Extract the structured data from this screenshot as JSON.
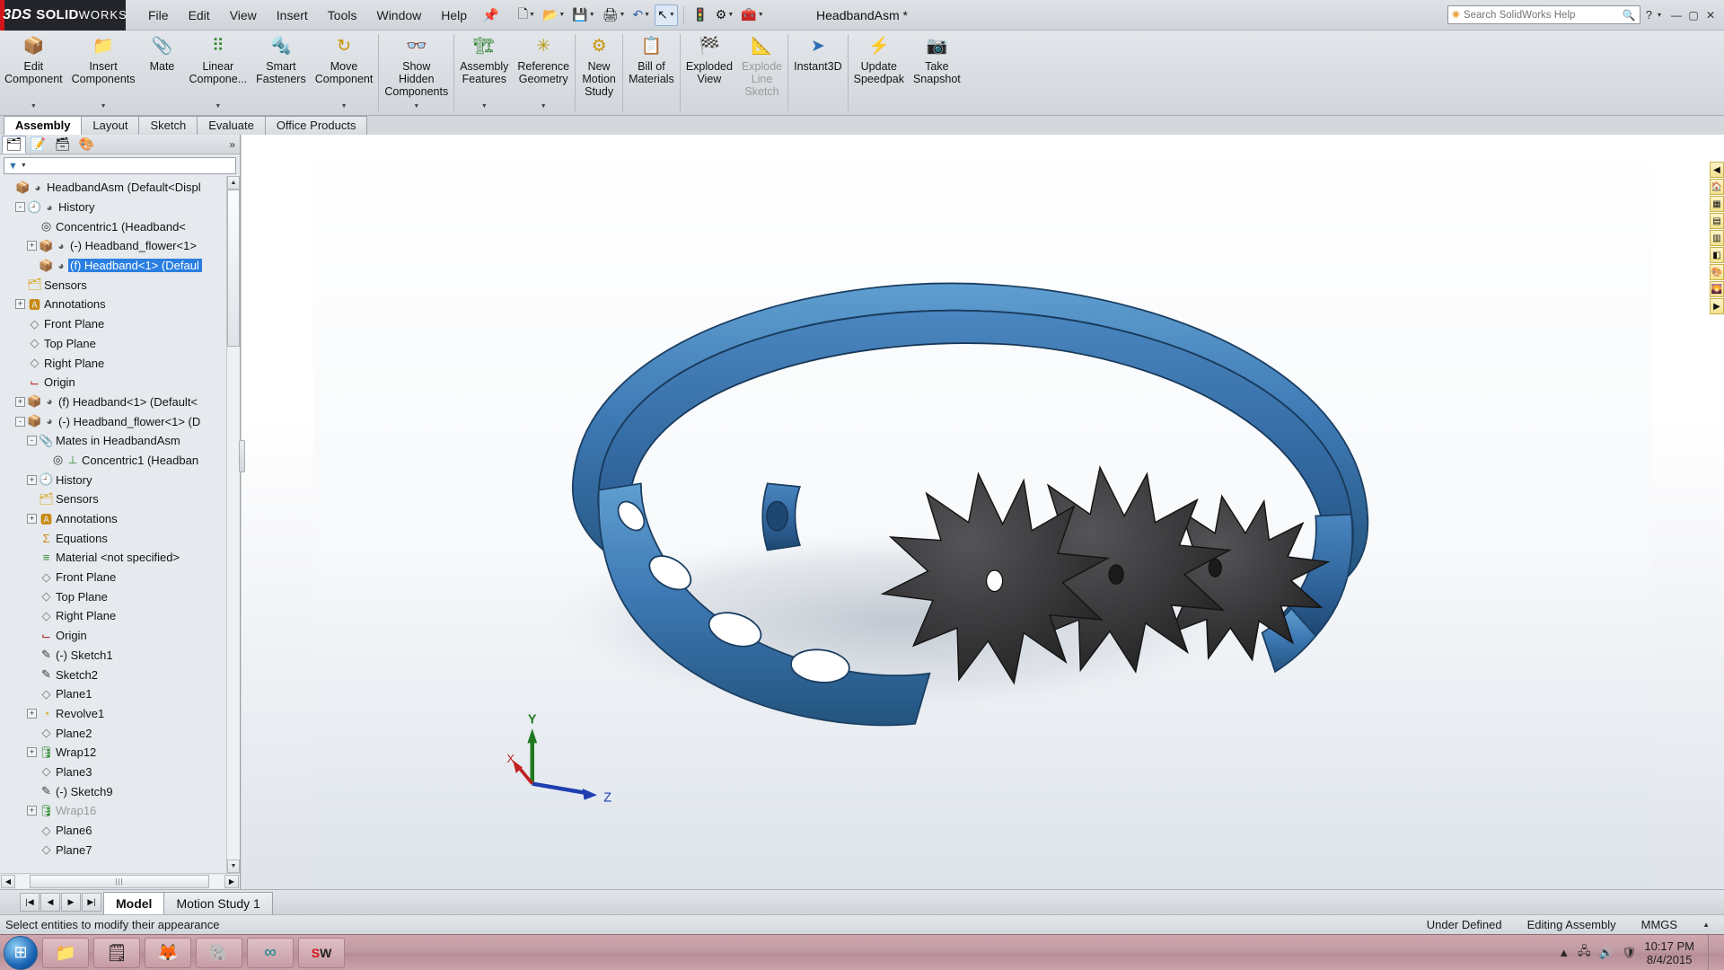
{
  "app": {
    "brand_d1": "3DS",
    "brand_d2": "SOLID",
    "brand_d3": "WORKS",
    "document_title": "HeadbandAsm *"
  },
  "menu": {
    "items": [
      "File",
      "Edit",
      "View",
      "Insert",
      "Tools",
      "Window",
      "Help"
    ]
  },
  "quick_tools": [
    {
      "name": "new-document",
      "glyph": "🗋",
      "caret": true
    },
    {
      "name": "open-document",
      "glyph": "📂",
      "caret": true
    },
    {
      "name": "save-document",
      "glyph": "💾",
      "caret": true
    },
    {
      "name": "print",
      "glyph": "🖨",
      "caret": true
    },
    {
      "name": "undo",
      "glyph": "↶",
      "caret": true
    },
    {
      "name": "select",
      "glyph": "↖",
      "caret": true,
      "selected": true
    },
    {
      "name": "rebuild",
      "glyph": "🚦",
      "caret": false
    },
    {
      "name": "options",
      "glyph": "⚙",
      "caret": false
    },
    {
      "name": "toolbox",
      "glyph": "🧰",
      "caret": true
    }
  ],
  "search": {
    "placeholder": "Search SolidWorks Help",
    "value": ""
  },
  "window_controls": {
    "help_caret": "?",
    "minimize": "—",
    "maximize": "▢",
    "close": "✕"
  },
  "ribbon": {
    "groups": [
      {
        "buttons": [
          {
            "label": "Edit\nComponent",
            "icon": "edit-component-icon",
            "glyph": "📦",
            "caret": true,
            "disabled": false
          },
          {
            "label": "Insert\nComponents",
            "icon": "insert-components-icon",
            "glyph": "📁",
            "caret": true,
            "disabled": false
          },
          {
            "label": "Mate",
            "icon": "mate-icon",
            "glyph": "📎",
            "caret": false,
            "disabled": false
          },
          {
            "label": "Linear\nCompone...",
            "icon": "linear-component-pattern-icon",
            "glyph": "⠿",
            "caret": true,
            "disabled": false
          },
          {
            "label": "Smart\nFasteners",
            "icon": "smart-fasteners-icon",
            "glyph": "🔩",
            "caret": false,
            "disabled": false
          },
          {
            "label": "Move\nComponent",
            "icon": "move-component-icon",
            "glyph": "↻",
            "caret": true,
            "disabled": false
          }
        ]
      },
      {
        "buttons": [
          {
            "label": "Show\nHidden\nComponents",
            "icon": "show-hidden-components-icon",
            "glyph": "👁",
            "caret": true,
            "disabled": false
          }
        ]
      },
      {
        "buttons": [
          {
            "label": "Assembly\nFeatures",
            "icon": "assembly-features-icon",
            "glyph": "🏗",
            "caret": true,
            "disabled": false
          },
          {
            "label": "Reference\nGeometry",
            "icon": "reference-geometry-icon",
            "glyph": "✳",
            "caret": true,
            "disabled": false
          }
        ]
      },
      {
        "buttons": [
          {
            "label": "New\nMotion\nStudy",
            "icon": "new-motion-study-icon",
            "glyph": "⚙",
            "caret": false,
            "disabled": false
          }
        ]
      },
      {
        "buttons": [
          {
            "label": "Bill of\nMaterials",
            "icon": "bill-of-materials-icon",
            "glyph": "📋",
            "caret": false,
            "disabled": false
          }
        ]
      },
      {
        "buttons": [
          {
            "label": "Exploded\nView",
            "icon": "exploded-view-icon",
            "glyph": "🏁",
            "caret": false,
            "disabled": false
          },
          {
            "label": "Explode\nLine\nSketch",
            "icon": "explode-line-sketch-icon",
            "glyph": "📐",
            "caret": false,
            "disabled": true
          }
        ]
      },
      {
        "buttons": [
          {
            "label": "Instant3D",
            "icon": "instant3d-icon",
            "glyph": "➤",
            "caret": false,
            "disabled": false
          }
        ]
      },
      {
        "buttons": [
          {
            "label": "Update\nSpeedpak",
            "icon": "update-speedpak-icon",
            "glyph": "⚡",
            "caret": false,
            "disabled": false
          },
          {
            "label": "Take\nSnapshot",
            "icon": "take-snapshot-icon",
            "glyph": "📷",
            "caret": false,
            "disabled": false
          }
        ]
      }
    ]
  },
  "command_tabs": {
    "items": [
      "Assembly",
      "Layout",
      "Sketch",
      "Evaluate",
      "Office Products"
    ],
    "active": "Assembly"
  },
  "left_panel": {
    "tabs": [
      {
        "name": "feature-manager-tab",
        "glyph": "🗂",
        "active": true
      },
      {
        "name": "property-manager-tab",
        "glyph": "📝",
        "active": false
      },
      {
        "name": "configuration-manager-tab",
        "glyph": "🗃",
        "active": false
      },
      {
        "name": "display-manager-tab",
        "glyph": "🎨",
        "active": false
      }
    ],
    "filter_placeholder": "",
    "tree": [
      {
        "indent": 0,
        "expander": "",
        "icon": "assembly-icon",
        "icon2": "coordinate-icon",
        "label": "HeadbandAsm  (Default<Displ",
        "selected": false,
        "dim": false
      },
      {
        "indent": 1,
        "expander": "-",
        "icon": "history-icon",
        "icon2": "coordinate-icon",
        "label": "History",
        "selected": false,
        "dim": false
      },
      {
        "indent": 2,
        "expander": "",
        "icon": "concentric-mate-icon",
        "icon2": "",
        "label": "Concentric1 (Headband<",
        "selected": false,
        "dim": false
      },
      {
        "indent": 2,
        "expander": "+",
        "icon": "part-icon",
        "icon2": "coordinate-icon",
        "label": "(-) Headband_flower<1>",
        "selected": false,
        "dim": false
      },
      {
        "indent": 2,
        "expander": "",
        "icon": "part-icon",
        "icon2": "coordinate-icon",
        "label": "(f) Headband<1> (Defaul",
        "selected": true,
        "dim": false
      },
      {
        "indent": 1,
        "expander": "",
        "icon": "sensors-icon",
        "icon2": "",
        "label": "Sensors",
        "selected": false,
        "dim": false
      },
      {
        "indent": 1,
        "expander": "+",
        "icon": "annotations-icon",
        "icon2": "",
        "label": "Annotations",
        "selected": false,
        "dim": false
      },
      {
        "indent": 1,
        "expander": "",
        "icon": "plane-icon",
        "icon2": "",
        "label": "Front Plane",
        "selected": false,
        "dim": false
      },
      {
        "indent": 1,
        "expander": "",
        "icon": "plane-icon",
        "icon2": "",
        "label": "Top Plane",
        "selected": false,
        "dim": false
      },
      {
        "indent": 1,
        "expander": "",
        "icon": "plane-icon",
        "icon2": "",
        "label": "Right Plane",
        "selected": false,
        "dim": false
      },
      {
        "indent": 1,
        "expander": "",
        "icon": "origin-icon",
        "icon2": "",
        "label": "Origin",
        "selected": false,
        "dim": false
      },
      {
        "indent": 1,
        "expander": "+",
        "icon": "part-icon",
        "icon2": "coordinate-icon",
        "label": "(f) Headband<1> (Default<",
        "selected": false,
        "dim": false
      },
      {
        "indent": 1,
        "expander": "-",
        "icon": "part-icon",
        "icon2": "coordinate-icon",
        "label": "(-) Headband_flower<1> (D",
        "selected": false,
        "dim": false
      },
      {
        "indent": 2,
        "expander": "-",
        "icon": "mates-folder-icon",
        "icon2": "",
        "label": "Mates in HeadbandAsm",
        "selected": false,
        "dim": false
      },
      {
        "indent": 3,
        "expander": "",
        "icon": "concentric-mate-icon",
        "icon2": "fixed-icon",
        "label": "Concentric1 (Headban",
        "selected": false,
        "dim": false
      },
      {
        "indent": 2,
        "expander": "+",
        "icon": "history-icon",
        "icon2": "",
        "label": "History",
        "selected": false,
        "dim": false
      },
      {
        "indent": 2,
        "expander": "",
        "icon": "sensors-icon",
        "icon2": "",
        "label": "Sensors",
        "selected": false,
        "dim": false
      },
      {
        "indent": 2,
        "expander": "+",
        "icon": "annotations-icon",
        "icon2": "",
        "label": "Annotations",
        "selected": false,
        "dim": false
      },
      {
        "indent": 2,
        "expander": "",
        "icon": "equations-icon",
        "icon2": "",
        "label": "Equations",
        "selected": false,
        "dim": false
      },
      {
        "indent": 2,
        "expander": "",
        "icon": "material-icon",
        "icon2": "",
        "label": "Material <not specified>",
        "selected": false,
        "dim": false
      },
      {
        "indent": 2,
        "expander": "",
        "icon": "plane-icon",
        "icon2": "",
        "label": "Front Plane",
        "selected": false,
        "dim": false
      },
      {
        "indent": 2,
        "expander": "",
        "icon": "plane-icon",
        "icon2": "",
        "label": "Top Plane",
        "selected": false,
        "dim": false
      },
      {
        "indent": 2,
        "expander": "",
        "icon": "plane-icon",
        "icon2": "",
        "label": "Right Plane",
        "selected": false,
        "dim": false
      },
      {
        "indent": 2,
        "expander": "",
        "icon": "origin-icon",
        "icon2": "",
        "label": "Origin",
        "selected": false,
        "dim": false
      },
      {
        "indent": 2,
        "expander": "",
        "icon": "sketch-icon",
        "icon2": "",
        "label": "(-) Sketch1",
        "selected": false,
        "dim": false
      },
      {
        "indent": 2,
        "expander": "",
        "icon": "sketch-icon",
        "icon2": "",
        "label": "Sketch2",
        "selected": false,
        "dim": false
      },
      {
        "indent": 2,
        "expander": "",
        "icon": "plane-icon",
        "icon2": "",
        "label": "Plane1",
        "selected": false,
        "dim": false
      },
      {
        "indent": 2,
        "expander": "+",
        "icon": "revolve-icon",
        "icon2": "",
        "label": "Revolve1",
        "selected": false,
        "dim": false
      },
      {
        "indent": 2,
        "expander": "",
        "icon": "plane-icon",
        "icon2": "",
        "label": "Plane2",
        "selected": false,
        "dim": false
      },
      {
        "indent": 2,
        "expander": "+",
        "icon": "wrap-icon",
        "icon2": "",
        "label": "Wrap12",
        "selected": false,
        "dim": false
      },
      {
        "indent": 2,
        "expander": "",
        "icon": "plane-icon",
        "icon2": "",
        "label": "Plane3",
        "selected": false,
        "dim": false
      },
      {
        "indent": 2,
        "expander": "",
        "icon": "sketch-icon",
        "icon2": "",
        "label": "(-) Sketch9",
        "selected": false,
        "dim": false
      },
      {
        "indent": 2,
        "expander": "+",
        "icon": "wrap-icon",
        "icon2": "",
        "label": "Wrap16",
        "selected": false,
        "dim": true
      },
      {
        "indent": 2,
        "expander": "",
        "icon": "plane-icon",
        "icon2": "",
        "label": "Plane6",
        "selected": false,
        "dim": false
      },
      {
        "indent": 2,
        "expander": "",
        "icon": "plane-icon",
        "icon2": "",
        "label": "Plane7",
        "selected": false,
        "dim": false
      }
    ]
  },
  "view_toolbar": [
    {
      "name": "zoom-to-fit-icon",
      "glyph": "🔍",
      "caret": false
    },
    {
      "name": "zoom-to-area-icon",
      "glyph": "🔎",
      "caret": false
    },
    {
      "name": "previous-view-icon",
      "glyph": "↺",
      "caret": false
    },
    {
      "name": "section-view-icon",
      "glyph": "◨",
      "caret": false
    },
    {
      "name": "view-orientation-icon",
      "glyph": "⬛",
      "caret": false
    },
    {
      "name": "display-style-icon",
      "glyph": "▣",
      "caret": true
    },
    {
      "name": "hide-show-items-icon",
      "glyph": "👓",
      "caret": true
    },
    {
      "name": "edit-appearance-icon",
      "glyph": "🎨",
      "caret": true
    },
    {
      "name": "apply-scene-icon",
      "glyph": "🌄",
      "caret": true
    },
    {
      "name": "view-settings-icon",
      "glyph": "🖵",
      "caret": true
    }
  ],
  "graphics_window_controls": {
    "restore_all": "⧉",
    "tile": "⊞",
    "minimize": "—",
    "restore": "❐",
    "close": "✕"
  },
  "triad": {
    "x_label": "X",
    "y_label": "Y",
    "z_label": "Z",
    "x_color": "#c02020",
    "y_color": "#1f7a1f",
    "z_color": "#1f3fb0"
  },
  "model": {
    "headband_color": "#3f7ab5",
    "headband_dark": "#2d5c8d",
    "flower_color": "#3a3a3a",
    "flower_dark": "#262626",
    "shadow_color": "#c9ced6"
  },
  "bottom": {
    "nav_buttons": [
      "|◀",
      "◀",
      "▶",
      "▶|"
    ],
    "tabs": [
      {
        "label": "Model",
        "active": true
      },
      {
        "label": "Motion Study 1",
        "active": false
      }
    ]
  },
  "status_bar": {
    "message": "Select entities to modify their appearance",
    "state": "Under Defined",
    "mode": "Editing Assembly",
    "units": "MMGS",
    "caret": "▲"
  },
  "taskbar": {
    "start_glyph": "⊞",
    "items": [
      {
        "name": "file-explorer",
        "glyph": "📁"
      },
      {
        "name": "sticky-notes",
        "glyph": "🗒"
      },
      {
        "name": "firefox",
        "glyph": "🦊"
      },
      {
        "name": "evernote",
        "glyph": "🐘"
      },
      {
        "name": "arduino-ide",
        "glyph": "∞"
      },
      {
        "name": "solidworks",
        "glyph": "SW"
      }
    ],
    "tray": [
      "▲",
      "🖧",
      "🔊",
      "🛡"
    ],
    "clock_time": "10:17 PM",
    "clock_date": "8/4/2015"
  }
}
